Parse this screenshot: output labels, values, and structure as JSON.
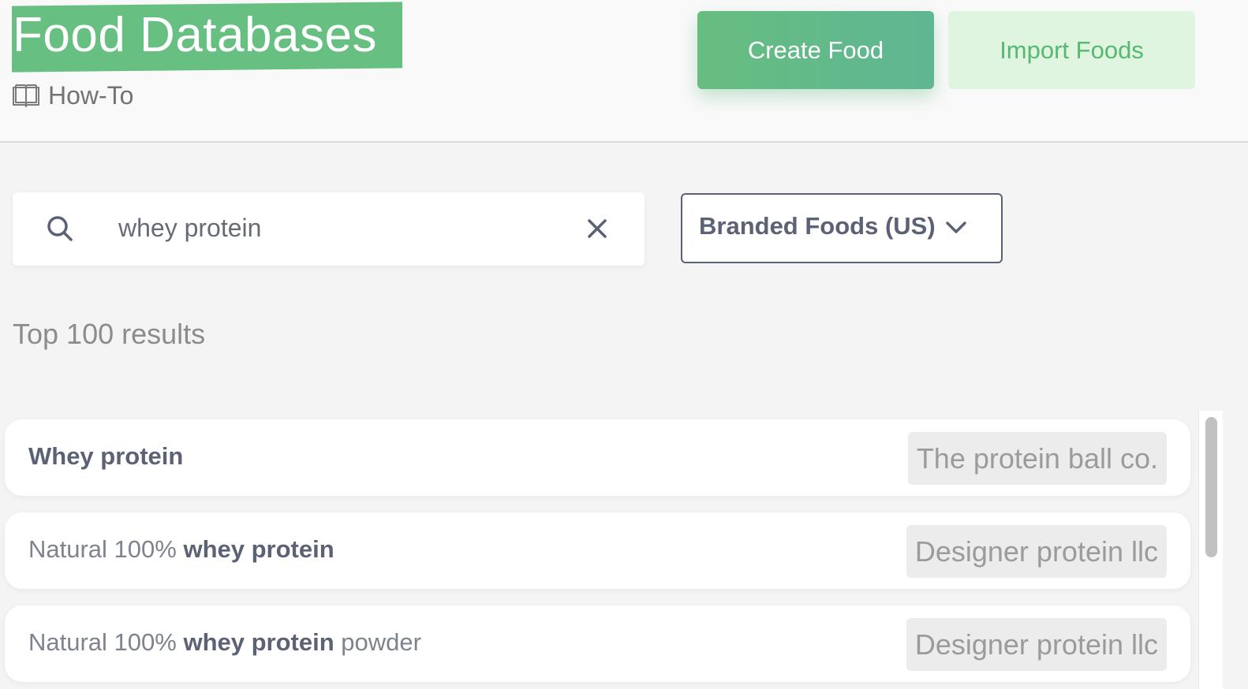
{
  "header": {
    "title": "Food Databases",
    "howto_label": "How-To",
    "create_button": "Create Food",
    "import_button": "Import Foods"
  },
  "search": {
    "value": "whey protein",
    "placeholder": ""
  },
  "database_select": {
    "selected": "Branded Foods (US)"
  },
  "results": {
    "count_label": "Top 100 results",
    "items": [
      {
        "prefix": "",
        "match": "Whey protein",
        "suffix": "",
        "brand": "The protein ball co."
      },
      {
        "prefix": "Natural 100% ",
        "match": "whey protein",
        "suffix": "",
        "brand": "Designer protein llc"
      },
      {
        "prefix": "Natural 100% ",
        "match": "whey protein",
        "suffix": " powder",
        "brand": "Designer protein llc"
      }
    ]
  },
  "icons": {
    "howto": "book-icon",
    "search": "search-icon",
    "clear": "close-icon",
    "select": "chevron-down-icon"
  },
  "colors": {
    "accent_green": "#67c082",
    "import_bg": "#dff5e0",
    "text_dark": "#5c6275"
  }
}
